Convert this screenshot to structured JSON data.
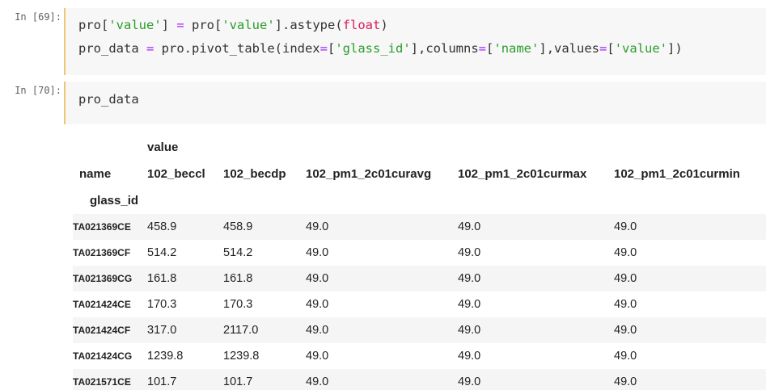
{
  "cells": [
    {
      "prompt": "In [69]:",
      "lines": [
        [
          {
            "t": "pro[",
            "c": ""
          },
          {
            "t": "'value'",
            "c": "s"
          },
          {
            "t": "] ",
            "c": ""
          },
          {
            "t": "=",
            "c": "o"
          },
          {
            "t": " pro[",
            "c": ""
          },
          {
            "t": "'value'",
            "c": "s"
          },
          {
            "t": "].astype(",
            "c": ""
          },
          {
            "t": "float",
            "c": "b"
          },
          {
            "t": ")",
            "c": ""
          }
        ],
        [
          {
            "t": "pro_data ",
            "c": ""
          },
          {
            "t": "=",
            "c": "o"
          },
          {
            "t": " pro.pivot_table(index",
            "c": ""
          },
          {
            "t": "=",
            "c": "o"
          },
          {
            "t": "[",
            "c": ""
          },
          {
            "t": "'glass_id'",
            "c": "s"
          },
          {
            "t": "],columns",
            "c": ""
          },
          {
            "t": "=",
            "c": "o"
          },
          {
            "t": "[",
            "c": ""
          },
          {
            "t": "'name'",
            "c": "s"
          },
          {
            "t": "],values",
            "c": ""
          },
          {
            "t": "=",
            "c": "o"
          },
          {
            "t": "[",
            "c": ""
          },
          {
            "t": "'value'",
            "c": "s"
          },
          {
            "t": "])",
            "c": ""
          }
        ]
      ]
    },
    {
      "prompt": "In [70]:",
      "lines": [
        [
          {
            "t": "pro_data",
            "c": ""
          }
        ]
      ]
    }
  ],
  "table": {
    "top_level": "value",
    "columns_name": "name",
    "index_name": "glass_id",
    "columns": [
      "102_beccl",
      "102_becdp",
      "102_pm1_2c01curavg",
      "102_pm1_2c01curmax",
      "102_pm1_2c01curmin"
    ],
    "rows": [
      {
        "index": "TA021369CE",
        "values": [
          "458.9",
          "458.9",
          "49.0",
          "49.0",
          "49.0"
        ]
      },
      {
        "index": "TA021369CF",
        "values": [
          "514.2",
          "514.2",
          "49.0",
          "49.0",
          "49.0"
        ]
      },
      {
        "index": "TA021369CG",
        "values": [
          "161.8",
          "161.8",
          "49.0",
          "49.0",
          "49.0"
        ]
      },
      {
        "index": "TA021424CE",
        "values": [
          "170.3",
          "170.3",
          "49.0",
          "49.0",
          "49.0"
        ]
      },
      {
        "index": "TA021424CF",
        "values": [
          "317.0",
          "2117.0",
          "49.0",
          "49.0",
          "49.0"
        ]
      },
      {
        "index": "TA021424CG",
        "values": [
          "1239.8",
          "1239.8",
          "49.0",
          "49.0",
          "49.0"
        ]
      },
      {
        "index": "TA021571CE",
        "values": [
          "101.7",
          "101.7",
          "49.0",
          "49.0",
          "49.0"
        ]
      }
    ]
  }
}
